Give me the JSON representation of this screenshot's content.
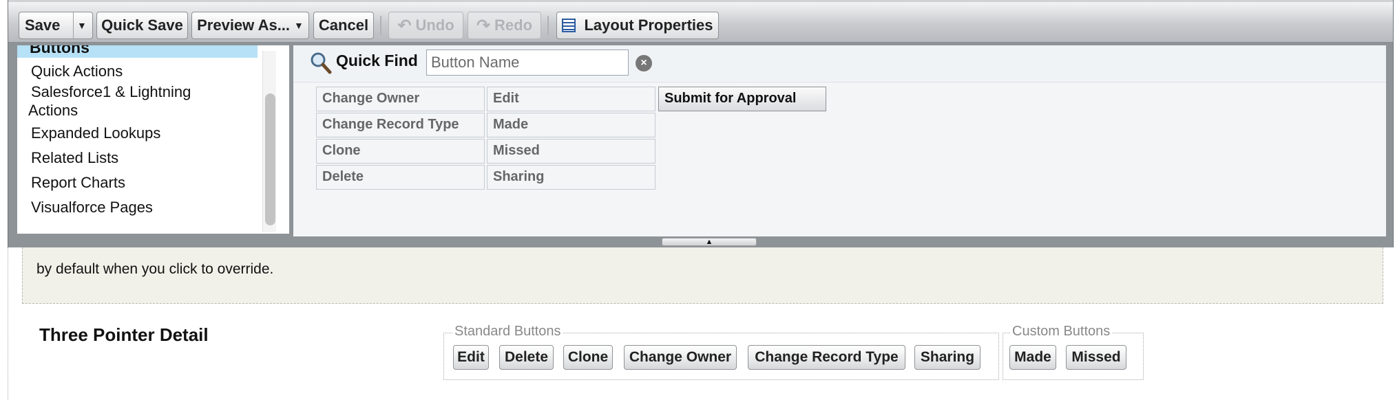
{
  "toolbar": {
    "save_label": "Save",
    "quick_save_label": "Quick Save",
    "preview_as_label": "Preview As...",
    "cancel_label": "Cancel",
    "undo_label": "Undo",
    "redo_label": "Redo",
    "layout_properties_label": "Layout Properties"
  },
  "palette": {
    "selected_category": "Buttons",
    "categories": [
      "Quick Actions",
      "Salesforce1 & Lightning Actions",
      "Expanded Lookups",
      "Related Lists",
      "Report Charts",
      "Visualforce Pages"
    ],
    "category_lines": [
      "Salesforce1 & Lightning",
      "Actions"
    ]
  },
  "quick_find": {
    "label": "Quick Find",
    "placeholder": "Button Name"
  },
  "palette_buttons": {
    "col1": [
      "Change Owner",
      "Change Record Type",
      "Clone",
      "Delete"
    ],
    "col2": [
      "Edit",
      "Made",
      "Missed",
      "Sharing"
    ],
    "active": "Submit for Approval"
  },
  "page": {
    "info_text": "by default when you click to override.",
    "section_title": "Three Pointer Detail",
    "standard_legend": "Standard Buttons",
    "custom_legend": "Custom Buttons",
    "standard_buttons": [
      "Edit",
      "Delete",
      "Clone",
      "Change Owner",
      "Change Record Type",
      "Sharing"
    ],
    "custom_buttons": [
      "Made",
      "Missed"
    ]
  },
  "colors": {
    "selected_category_bg": "#b6e1f6",
    "editor_frame": "#8e9397",
    "info_box_bg": "#f2f1e9"
  }
}
